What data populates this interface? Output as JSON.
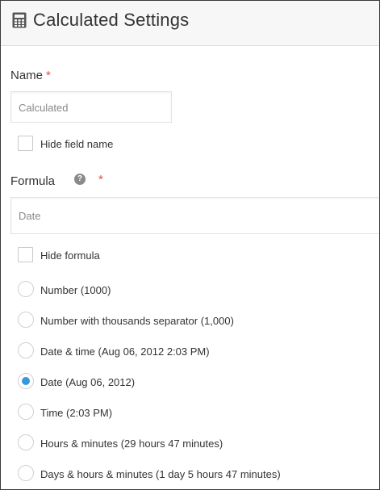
{
  "header": {
    "icon": "calculator-icon",
    "title": "Calculated Settings"
  },
  "name_field": {
    "label": "Name",
    "required_mark": "*",
    "value": "Calculated",
    "hide_label": "Hide field name",
    "hide_checked": false
  },
  "formula_field": {
    "label": "Formula",
    "help_icon": "help-icon",
    "help_glyph": "?",
    "required_mark": "*",
    "value": "Date",
    "hide_label": "Hide formula",
    "hide_checked": false
  },
  "format_options": [
    {
      "label": "Number (1000)",
      "selected": false
    },
    {
      "label": "Number with thousands separator (1,000)",
      "selected": false
    },
    {
      "label": "Date & time (Aug 06, 2012 2:03 PM)",
      "selected": false
    },
    {
      "label": "Date (Aug 06, 2012)",
      "selected": true
    },
    {
      "label": "Time (2:03 PM)",
      "selected": false
    },
    {
      "label": "Hours & minutes (29 hours 47 minutes)",
      "selected": false
    },
    {
      "label": "Days & hours & minutes (1 day 5 hours 47 minutes)",
      "selected": false
    }
  ],
  "colors": {
    "required": "#e74c3c",
    "radio_selected": "#3498db"
  }
}
